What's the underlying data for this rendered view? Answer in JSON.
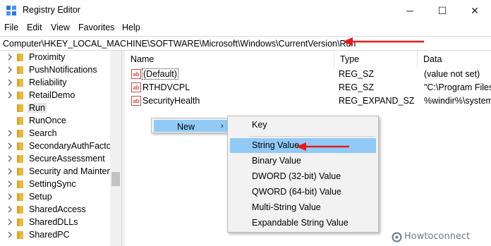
{
  "window": {
    "title": "Registry Editor",
    "controls": {
      "minimize": "─",
      "maximize": "☐",
      "close": "✕"
    }
  },
  "menubar": [
    "File",
    "Edit",
    "View",
    "Favorites",
    "Help"
  ],
  "address": {
    "path": "Computer\\HKEY_LOCAL_MACHINE\\SOFTWARE\\Microsoft\\Windows\\CurrentVersion\\Run"
  },
  "tree": {
    "items": [
      {
        "label": "Proximity",
        "expandable": true
      },
      {
        "label": "PushNotifications",
        "expandable": true
      },
      {
        "label": "Reliability",
        "expandable": true
      },
      {
        "label": "RetailDemo",
        "expandable": true
      },
      {
        "label": "Run",
        "expandable": false,
        "selected": true
      },
      {
        "label": "RunOnce",
        "expandable": false
      },
      {
        "label": "Search",
        "expandable": true
      },
      {
        "label": "SecondaryAuthFactor",
        "expandable": true
      },
      {
        "label": "SecureAssessment",
        "expandable": true
      },
      {
        "label": "Security and Maintenance",
        "expandable": true
      },
      {
        "label": "SettingSync",
        "expandable": true
      },
      {
        "label": "Setup",
        "expandable": true
      },
      {
        "label": "SharedAccess",
        "expandable": true
      },
      {
        "label": "SharedDLLs",
        "expandable": true
      },
      {
        "label": "SharedPC",
        "expandable": true
      }
    ]
  },
  "columns": {
    "name": "Name",
    "type": "Type",
    "data": "Data"
  },
  "values": [
    {
      "name": "(Default)",
      "type": "REG_SZ",
      "data": "(value not set)",
      "icon": "string-value-icon"
    },
    {
      "name": "RTHDVCPL",
      "type": "REG_SZ",
      "data": "\"C:\\Program Files\\",
      "icon": "string-value-icon"
    },
    {
      "name": "SecurityHealth",
      "type": "REG_EXPAND_SZ",
      "data": "%windir%\\system",
      "icon": "string-value-icon"
    }
  ],
  "context_menu": {
    "new_label": "New",
    "arrow": "›"
  },
  "submenu": {
    "items": [
      {
        "label": "Key",
        "highlighted": false
      },
      {
        "label": "String Value",
        "highlighted": true
      },
      {
        "label": "Binary Value",
        "highlighted": false
      },
      {
        "label": "DWORD (32-bit) Value",
        "highlighted": false
      },
      {
        "label": "QWORD (64-bit) Value",
        "highlighted": false
      },
      {
        "label": "Multi-String Value",
        "highlighted": false
      },
      {
        "label": "Expandable String Value",
        "highlighted": false
      }
    ]
  },
  "watermark": {
    "text": "Howtoconnect"
  },
  "colors": {
    "annotation_arrow": "#e21b1b",
    "menu_highlight": "#91c9f7",
    "folder": "#e8b941"
  }
}
